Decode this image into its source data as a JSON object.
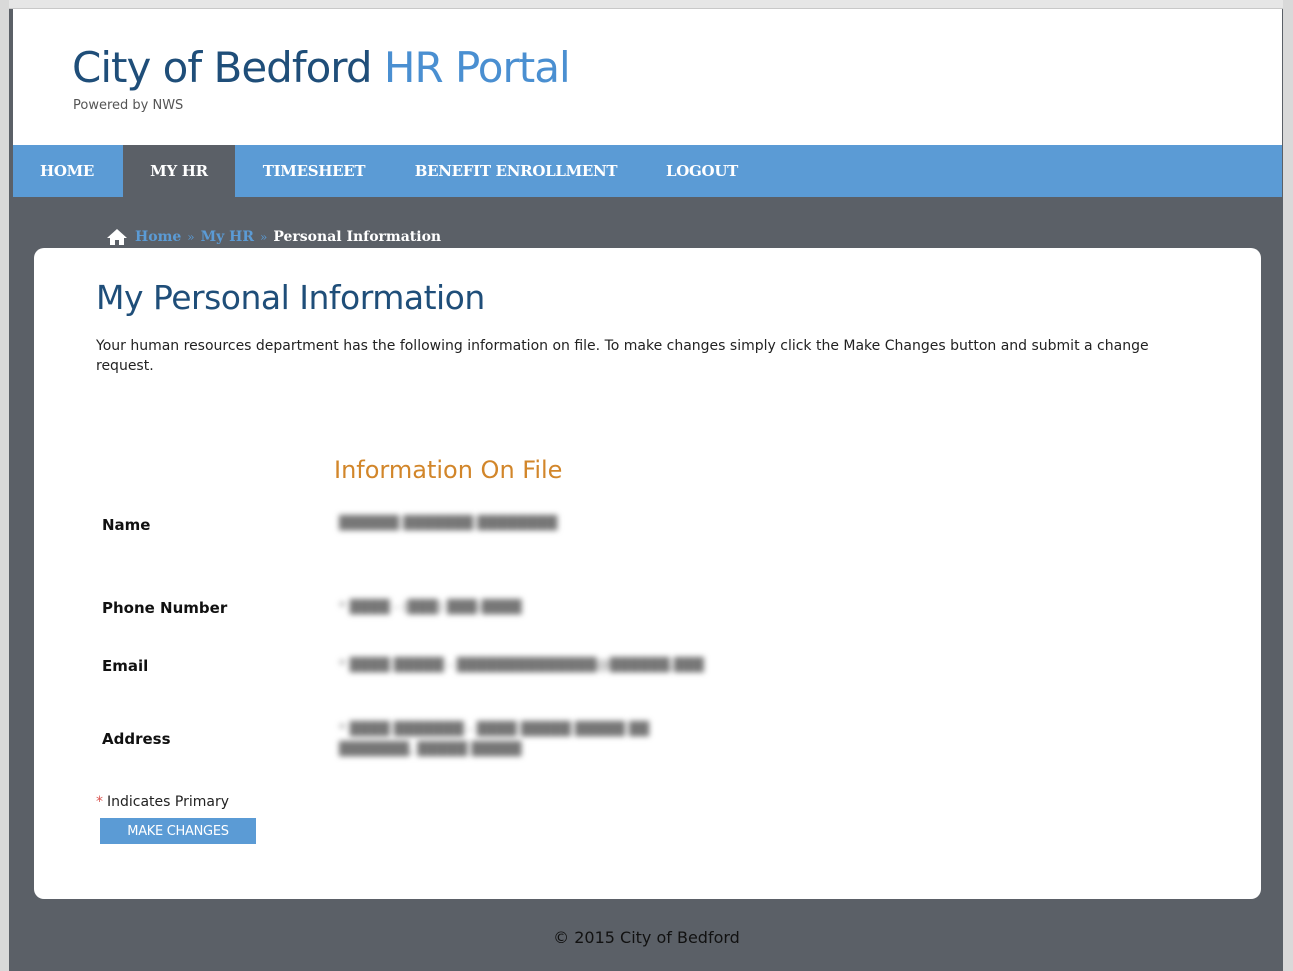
{
  "header": {
    "title_part1": "City of Bedford",
    "title_part2": "HR Portal",
    "subtitle": "Powered by NWS"
  },
  "nav": {
    "items": [
      {
        "label": "HOME",
        "active": false
      },
      {
        "label": "MY HR",
        "active": true
      },
      {
        "label": "TIMESHEET",
        "active": false
      },
      {
        "label": "BENEFIT ENROLLMENT",
        "active": false
      },
      {
        "label": "LOGOUT",
        "active": false
      }
    ]
  },
  "breadcrumb": {
    "home": "Home",
    "separator": "»",
    "myhr": "My HR",
    "current": "Personal Information"
  },
  "page": {
    "title": "My Personal Information",
    "intro": "Your human resources department has the following information on file. To make changes simply click the Make Changes button and submit a change request.",
    "section_title": "Information On File"
  },
  "fields": {
    "name_label": "Name",
    "phone_label": "Phone Number",
    "email_label": "Email",
    "address_label": "Address"
  },
  "legend": {
    "star": "*",
    "text": "Indicates Primary"
  },
  "actions": {
    "make_changes": "MAKE CHANGES"
  },
  "footer": {
    "text": "© 2015 City of Bedford"
  },
  "colors": {
    "nav_blue": "#5b9bd5",
    "title_dark_blue": "#1f4e79",
    "title_light_blue": "#4a8fd1",
    "section_orange": "#d2862a",
    "background_gray": "#5b6067"
  }
}
